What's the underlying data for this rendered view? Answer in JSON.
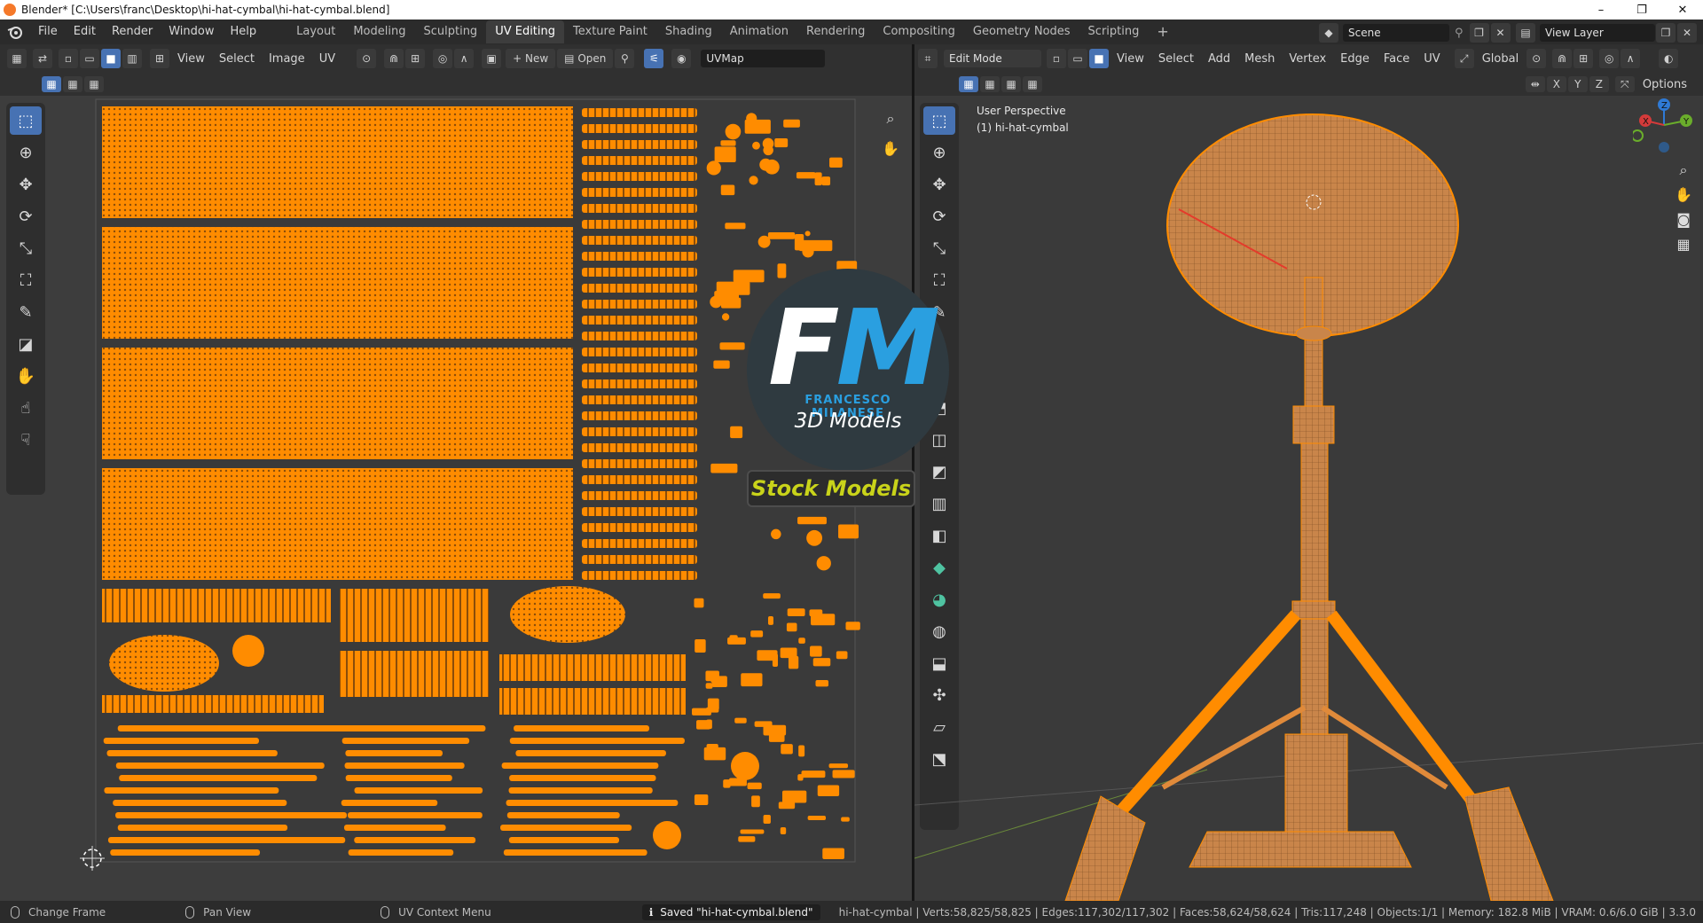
{
  "window": {
    "title": "Blender* [C:\\Users\\franc\\Desktop\\hi-hat-cymbal\\hi-hat-cymbal.blend]",
    "buttons": [
      "–",
      "❐",
      "✕"
    ]
  },
  "menu": [
    "File",
    "Edit",
    "Render",
    "Window",
    "Help"
  ],
  "workspaces": [
    "Layout",
    "Modeling",
    "Sculpting",
    "UV Editing",
    "Texture Paint",
    "Shading",
    "Animation",
    "Rendering",
    "Compositing",
    "Geometry Nodes",
    "Scripting"
  ],
  "active_workspace": "UV Editing",
  "scene": {
    "label": "Scene",
    "view_layer": "View Layer"
  },
  "uv_header": {
    "view": "View",
    "select": "Select",
    "image": "Image",
    "uv": "UV",
    "new": "New",
    "open": "Open",
    "uvmap": "UVMap"
  },
  "viewport_header": {
    "mode": "Edit Mode",
    "view": "View",
    "select": "Select",
    "add": "Add",
    "mesh": "Mesh",
    "vertex": "Vertex",
    "edge": "Edge",
    "face": "Face",
    "uv": "UV",
    "orientation": "Global",
    "options": "Options",
    "axes": [
      "X",
      "Y",
      "Z"
    ]
  },
  "viewport_overlay": {
    "perspective": "User Perspective",
    "object": "(1) hi-hat-cymbal"
  },
  "gizmo": {
    "x": "X",
    "y": "Y",
    "z": "Z"
  },
  "logo": {
    "initials_f": "F",
    "initials_m": "M",
    "name": "FRANCESCO MILANESE",
    "subtitle": "3D Models",
    "badge": "Stock Models"
  },
  "status": {
    "left1": "Change Frame",
    "left2": "Pan View",
    "left3": "UV Context Menu",
    "saved": "Saved \"hi-hat-cymbal.blend\"",
    "stats": "hi-hat-cymbal | Verts:58,825/58,825 | Edges:117,302/117,302 | Faces:58,624/58,624 | Tris:117,248 | Objects:1/1 | Memory: 182.8 MiB | VRAM: 0.6/6.0 GiB | 3.3.0"
  },
  "colors": {
    "uv_orange": "#ff8c00",
    "selection_blue": "#4772b3",
    "logo_blue": "#2a9fe0",
    "badge_yellow": "#c9d31a"
  }
}
